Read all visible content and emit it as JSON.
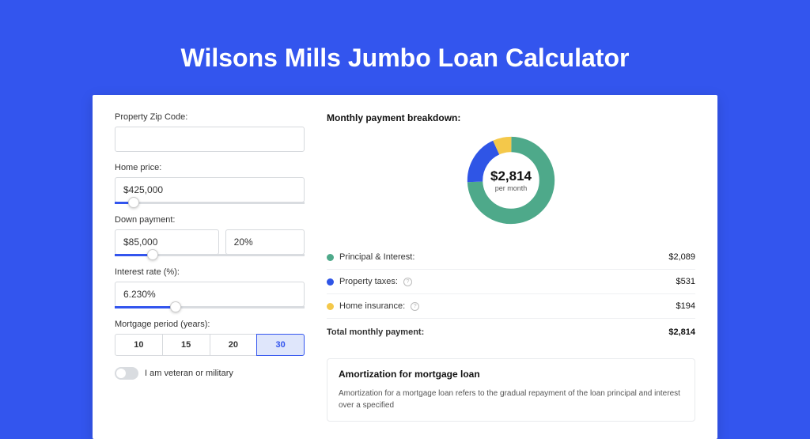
{
  "title": "Wilsons Mills Jumbo Loan Calculator",
  "form": {
    "zip_label": "Property Zip Code:",
    "zip_value": "",
    "price_label": "Home price:",
    "price_value": "$425,000",
    "down_label": "Down payment:",
    "down_value": "$85,000",
    "down_pct": "20%",
    "rate_label": "Interest rate (%):",
    "rate_value": "6.230%",
    "period_label": "Mortgage period (years):",
    "periods": [
      "10",
      "15",
      "20",
      "30"
    ],
    "period_active": "30",
    "veteran_label": "I am veteran or military"
  },
  "breakdown": {
    "title": "Monthly payment breakdown:",
    "center_amount": "$2,814",
    "center_sub": "per month",
    "items": [
      {
        "label": "Principal & Interest:",
        "value": "$2,089",
        "color": "#4ea98a",
        "info": false
      },
      {
        "label": "Property taxes:",
        "value": "$531",
        "color": "#2f55e6",
        "info": true
      },
      {
        "label": "Home insurance:",
        "value": "$194",
        "color": "#f4c84a",
        "info": true
      }
    ],
    "total_label": "Total monthly payment:",
    "total_value": "$2,814"
  },
  "chart_data": {
    "type": "pie",
    "title": "Monthly payment breakdown",
    "series": [
      {
        "name": "Principal & Interest",
        "value": 2089,
        "color": "#4ea98a"
      },
      {
        "name": "Property taxes",
        "value": 531,
        "color": "#2f55e6"
      },
      {
        "name": "Home insurance",
        "value": 194,
        "color": "#f4c84a"
      }
    ],
    "total": 2814
  },
  "amort": {
    "title": "Amortization for mortgage loan",
    "text": "Amortization for a mortgage loan refers to the gradual repayment of the loan principal and interest over a specified"
  }
}
